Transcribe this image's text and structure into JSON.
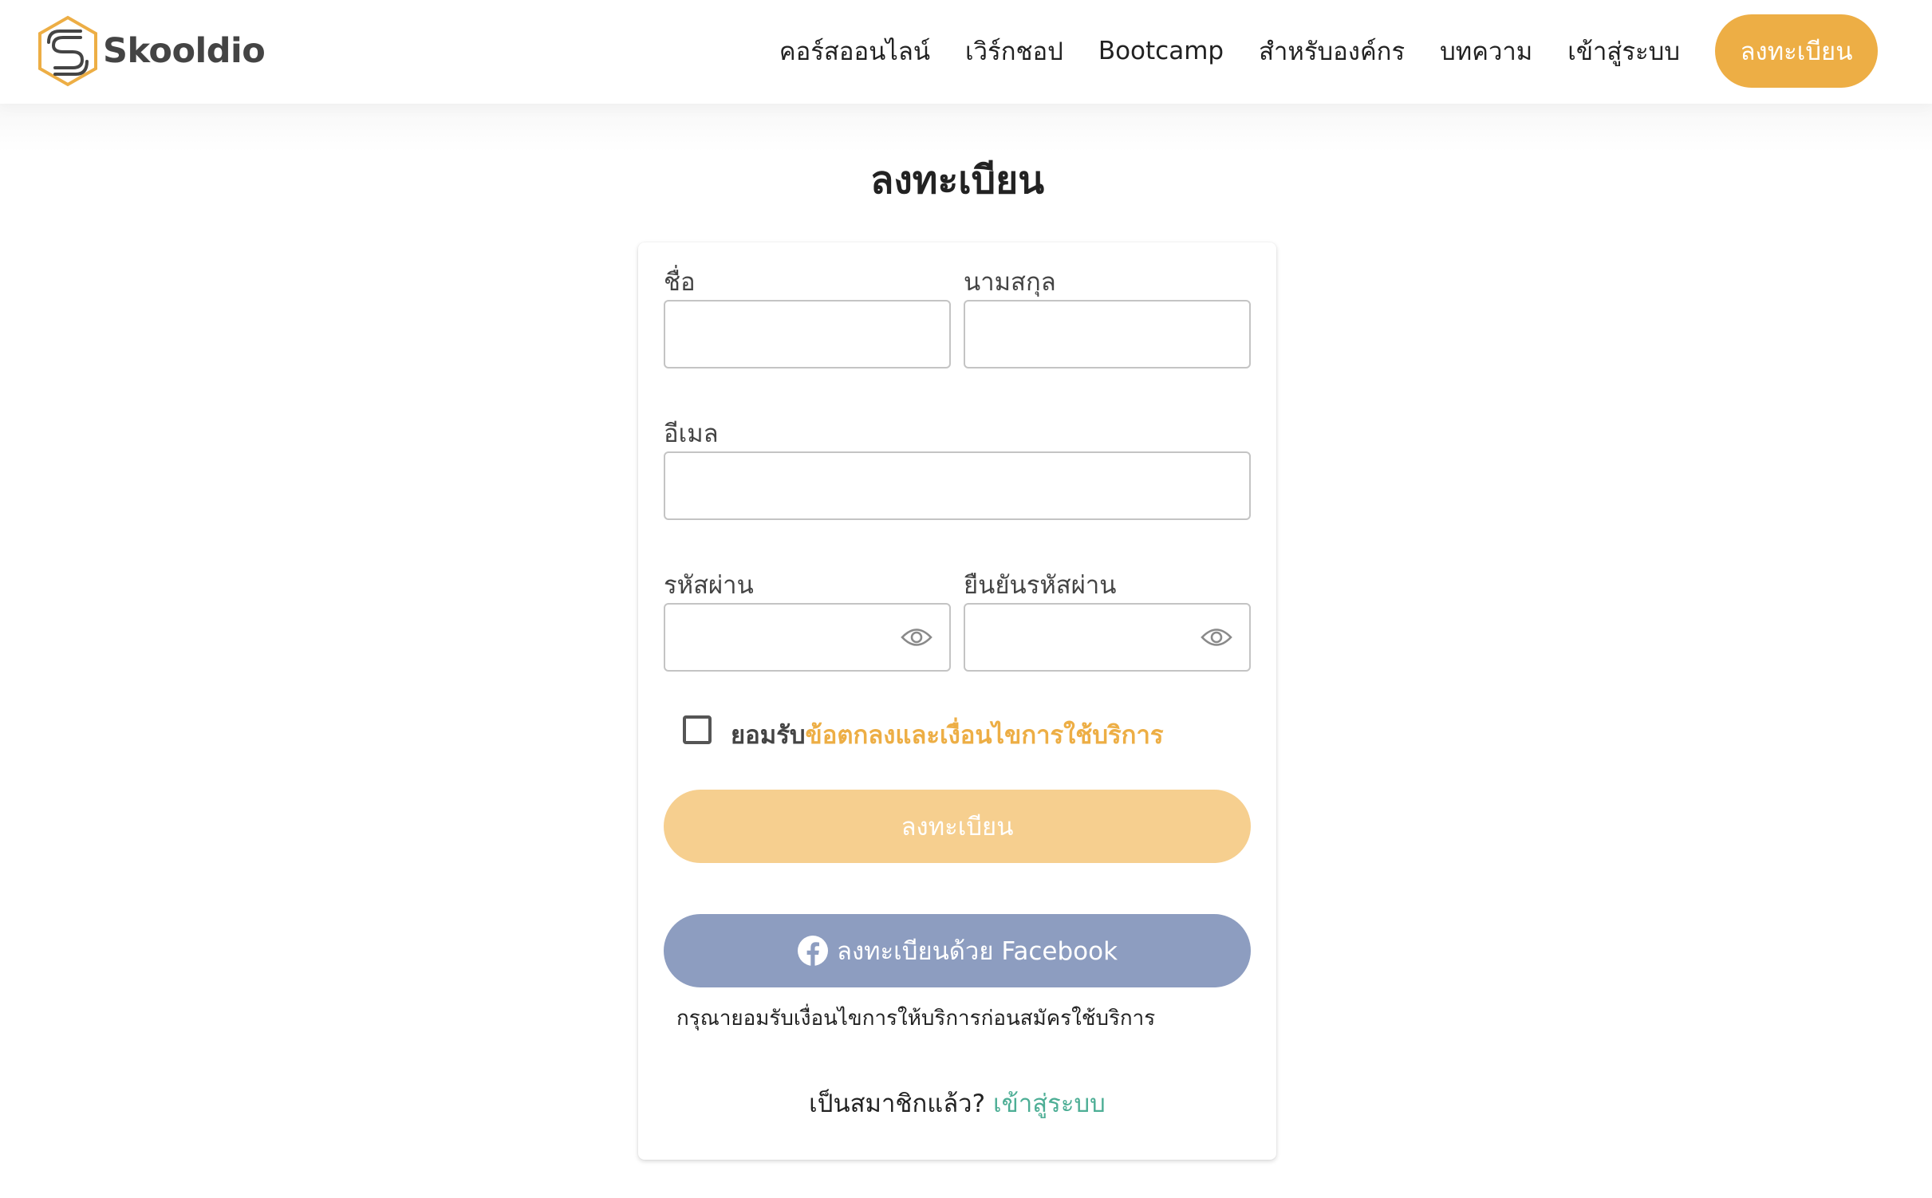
{
  "header": {
    "logo_text": "Skooldio",
    "nav": [
      {
        "label": "คอร์สออนไลน์"
      },
      {
        "label": "เวิร์กชอป"
      },
      {
        "label": "Bootcamp"
      },
      {
        "label": "สำหรับองค์กร"
      },
      {
        "label": "บทความ"
      },
      {
        "label": "เข้าสู่ระบบ"
      }
    ],
    "cta_label": "ลงทะเบียน"
  },
  "page": {
    "title": "ลงทะเบียน"
  },
  "form": {
    "first_name": {
      "label": "ชื่อ",
      "value": ""
    },
    "last_name": {
      "label": "นามสกุล",
      "value": ""
    },
    "email": {
      "label": "อีเมล",
      "value": ""
    },
    "password": {
      "label": "รหัสผ่าน",
      "value": "",
      "icon": "eye-icon"
    },
    "confirm_password": {
      "label": "ยืนยันรหัสผ่าน",
      "value": "",
      "icon": "eye-icon"
    },
    "terms": {
      "checked": false,
      "prefix": "ยอมรับ",
      "link": "ข้อตกลงและเงื่อนไขการใช้บริการ"
    },
    "submit_label": "ลงทะเบียน",
    "facebook_label": "ลงทะเบียนด้วย Facebook",
    "facebook_note": "กรุณายอมรับเงื่อนไขการให้บริการก่อนสมัครใช้บริการ",
    "login_prompt": "เป็นสมาชิกแล้ว?",
    "login_link": "เข้าสู่ระบบ"
  },
  "colors": {
    "accent": "#EDAE45",
    "accent_disabled": "#F6CF8F",
    "facebook_disabled": "#8D9DC0",
    "link_green": "#4DAE95"
  }
}
